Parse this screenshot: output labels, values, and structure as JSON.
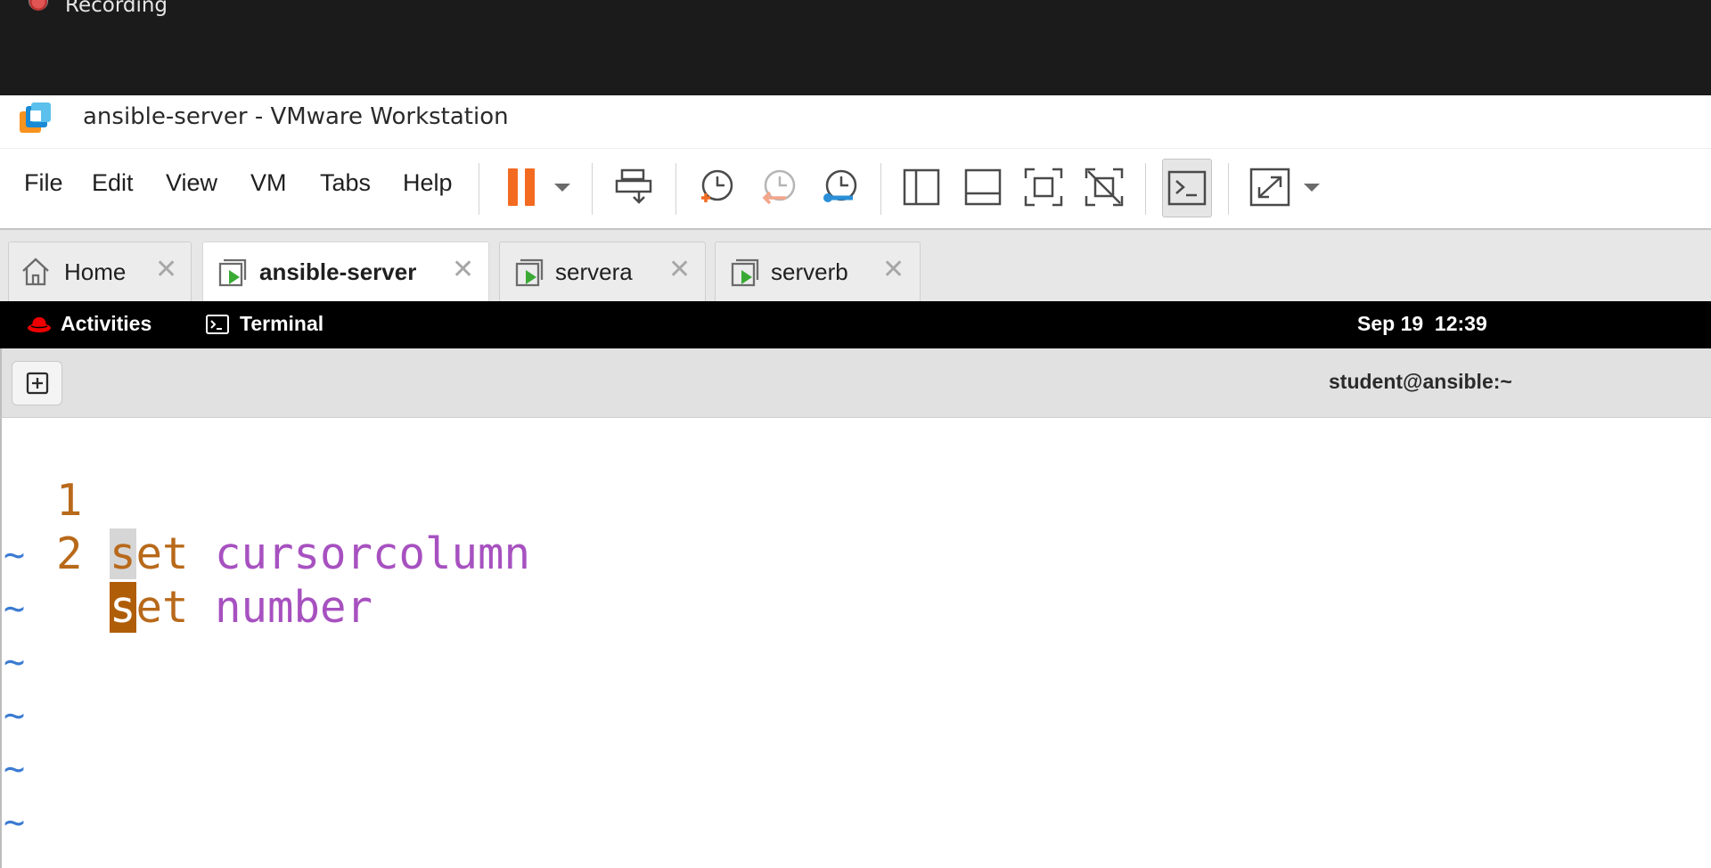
{
  "recording": {
    "label": "Recording"
  },
  "window": {
    "title": "ansible-server - VMware Workstation"
  },
  "menu": [
    "File",
    "Edit",
    "View",
    "VM",
    "Tabs",
    "Help"
  ],
  "toolbar": {
    "icons": [
      "pause-icon",
      "send-ctrl-alt-del-icon",
      "take-snapshot-icon",
      "revert-snapshot-icon",
      "snapshot-manager-icon",
      "show-library-icon",
      "thumbnail-bar-icon",
      "full-screen-icon",
      "unity-icon",
      "console-view-icon",
      "stretch-guest-icon"
    ],
    "accent": "#f36a21"
  },
  "tabs": [
    {
      "label": "Home",
      "icon": "home-icon",
      "active": false
    },
    {
      "label": "ansible-server",
      "icon": "vm-icon",
      "active": true
    },
    {
      "label": "servera",
      "icon": "vm-icon",
      "active": false
    },
    {
      "label": "serverb",
      "icon": "vm-icon",
      "active": false
    }
  ],
  "guest": {
    "activities": "Activities",
    "app": "Terminal",
    "clock": "Sep 19  12:39"
  },
  "terminal": {
    "title": "student@ansible:~",
    "lines": [
      {
        "num": "1",
        "keyword": "set",
        "value": "cursorcolumn"
      },
      {
        "num": "2",
        "keyword": "set",
        "value": "number"
      }
    ],
    "empty_marker": "~",
    "colors": {
      "line_number": "#b8691a",
      "keyword": "#b8691a",
      "value": "#a751c0",
      "cursor": "#b05d08",
      "tilde": "#3b7bd2"
    }
  }
}
